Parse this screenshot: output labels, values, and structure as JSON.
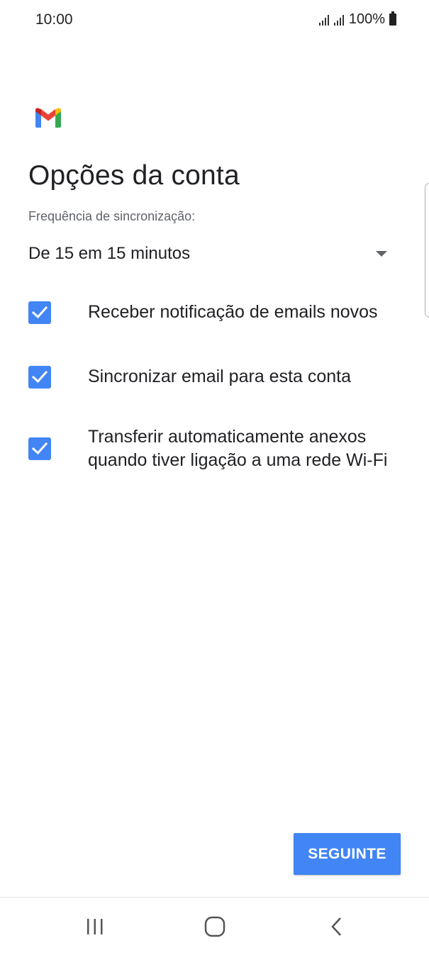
{
  "status_bar": {
    "time": "10:00",
    "battery": "100%"
  },
  "app": {
    "logo": "gmail-logo",
    "title": "Opções da conta"
  },
  "sync": {
    "label": "Frequência de sincronização:",
    "selected": "De 15 em 15 minutos"
  },
  "options": [
    {
      "label": "Receber notificação de emails novos",
      "checked": true
    },
    {
      "label": "Sincronizar email para esta conta",
      "checked": true
    },
    {
      "label": "Transferir automaticamente anexos quando tiver ligação a uma rede Wi-Fi",
      "checked": true
    }
  ],
  "next_button": {
    "label": "SEGUINTE"
  },
  "nav": {
    "items": [
      "recent-apps-icon",
      "home-icon",
      "back-icon"
    ]
  },
  "colors": {
    "accent": "#4285f4",
    "text": "#202124",
    "secondary_text": "#5f6368"
  }
}
